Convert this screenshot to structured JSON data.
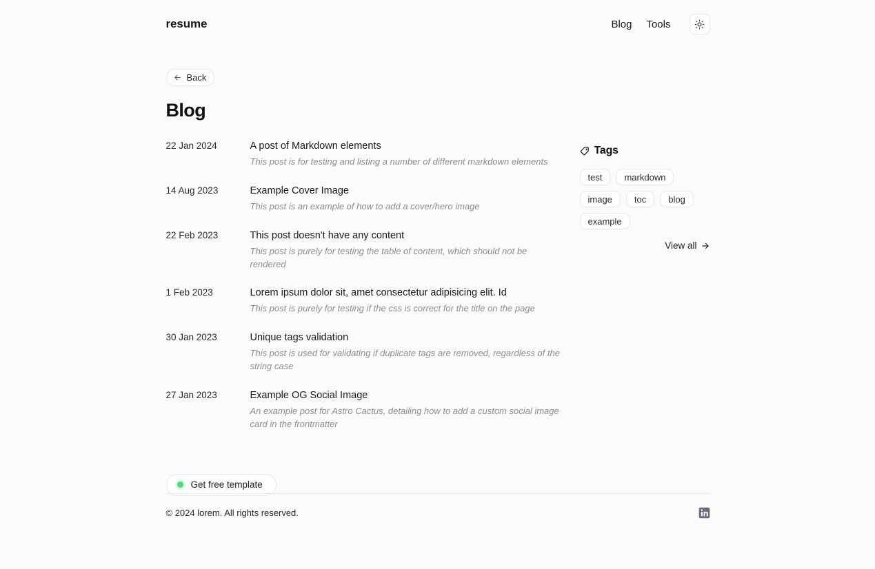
{
  "header": {
    "brand": "resume",
    "nav": [
      {
        "label": "Blog",
        "name": "nav-link-blog"
      },
      {
        "label": "Tools",
        "name": "nav-link-tools"
      }
    ],
    "theme_toggle_icon": "sun-icon"
  },
  "back": {
    "label": "Back",
    "icon": "arrow-left-icon"
  },
  "page": {
    "title": "Blog"
  },
  "posts": [
    {
      "date": "22 Jan 2024",
      "title": "A post of Markdown elements",
      "description": "This post is for testing and listing a number of different markdown elements"
    },
    {
      "date": "14 Aug 2023",
      "title": "Example Cover Image",
      "description": "This post is an example of how to add a cover/hero image"
    },
    {
      "date": "22 Feb 2023",
      "title": "This post doesn't have any content",
      "description": "This post is purely for testing the table of content, which should not be rendered"
    },
    {
      "date": "1 Feb 2023",
      "title": "Lorem ipsum dolor sit, amet consectetur adipisicing elit. Id",
      "description": "This post is purely for testing if the css is correct for the title on the page"
    },
    {
      "date": "30 Jan 2023",
      "title": "Unique tags validation",
      "description": "This post is used for validating if duplicate tags are removed, regardless of the string case"
    },
    {
      "date": "27 Jan 2023",
      "title": "Example OG Social Image",
      "description": "An example post for Astro Cactus, detailing how to add a custom social image card in the frontmatter"
    }
  ],
  "tags_panel": {
    "heading": "Tags",
    "heading_icon": "tags-icon",
    "tags": [
      {
        "label": "test"
      },
      {
        "label": "markdown"
      },
      {
        "label": "image"
      },
      {
        "label": "toc"
      },
      {
        "label": "blog"
      },
      {
        "label": "example"
      }
    ],
    "view_all": {
      "label": "View all",
      "icon": "arrow-right-icon"
    }
  },
  "cta": {
    "label": "Get free template",
    "dot_color": "#4ade80"
  },
  "footer": {
    "copyright": "© 2024 lorem. All rights reserved.",
    "social": [
      {
        "name": "linkedin-icon",
        "label": "in"
      }
    ]
  },
  "colors": {
    "background": "#fbfbfb",
    "surface": "#ffffff",
    "border": "#e9e9e9",
    "text": "#1a1a1a",
    "muted": "#8d8d8d",
    "accent": "#4ade80"
  }
}
